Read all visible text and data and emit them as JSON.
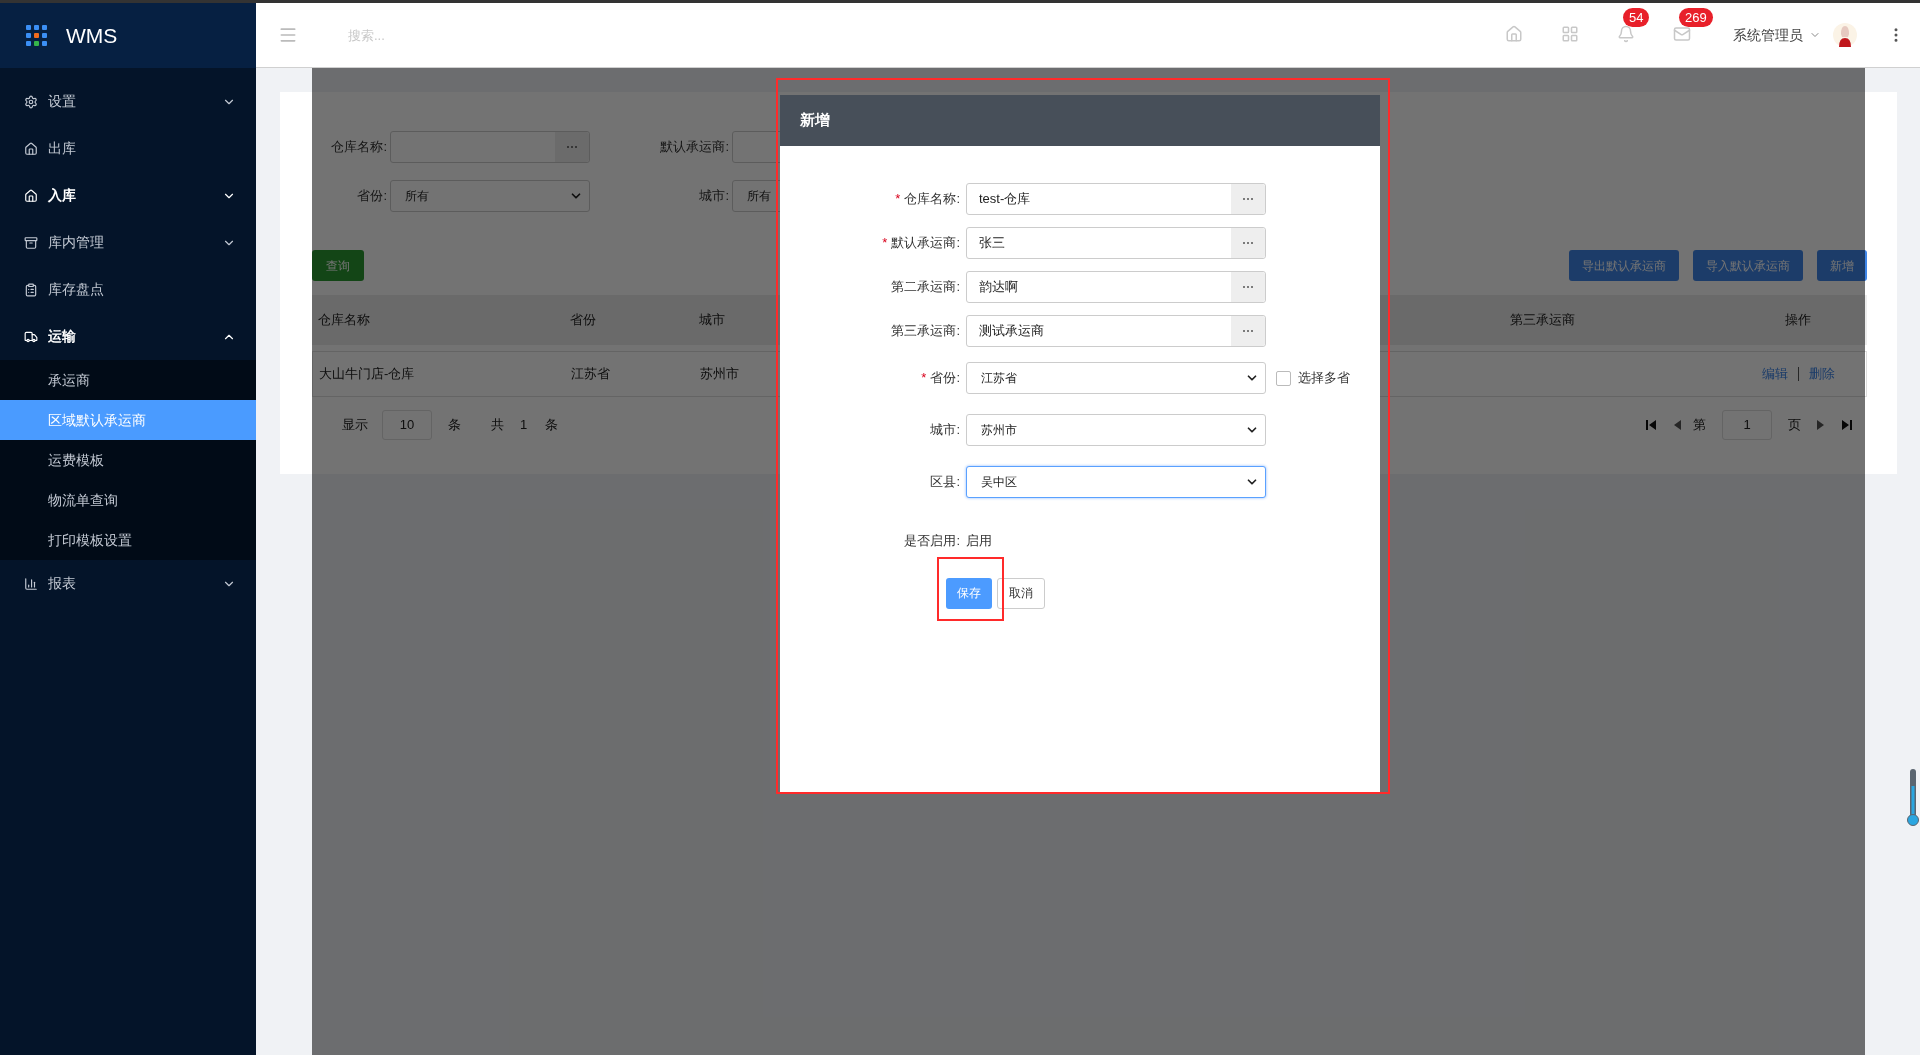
{
  "app": {
    "logo": "WMS"
  },
  "sidebar": {
    "items": [
      {
        "label": "设置",
        "kind": "group",
        "expanded": false,
        "bold": false
      },
      {
        "label": "出库",
        "kind": "link",
        "bold": false
      },
      {
        "label": "入库",
        "kind": "group",
        "expanded": false,
        "bold": true
      },
      {
        "label": "库内管理",
        "kind": "group",
        "expanded": false,
        "bold": false
      },
      {
        "label": "库存盘点",
        "kind": "link",
        "bold": false
      },
      {
        "label": "运输",
        "kind": "group",
        "expanded": true,
        "bold": true,
        "children": [
          {
            "label": "承运商",
            "selected": false
          },
          {
            "label": "区域默认承运商",
            "selected": true
          },
          {
            "label": "运费模板",
            "selected": false
          },
          {
            "label": "物流单查询",
            "selected": false
          },
          {
            "label": "打印模板设置",
            "selected": false
          }
        ]
      },
      {
        "label": "报表",
        "kind": "group",
        "expanded": false,
        "bold": false
      }
    ]
  },
  "header": {
    "search": {
      "placeholder": "搜索..."
    },
    "badges": [
      "54",
      "269"
    ],
    "user": "系统管理员"
  },
  "filters": [
    {
      "label": "仓库名称:",
      "kind": "picker"
    },
    {
      "label": "默认承运商:",
      "kind": "picker"
    },
    {
      "label": "省份:",
      "kind": "select",
      "value": "所有"
    },
    {
      "label": "城市:",
      "kind": "select",
      "value": "所有"
    }
  ],
  "query_button": "查询",
  "actions": [
    "导出默认承运商",
    "导入默认承运商",
    "新增"
  ],
  "table": {
    "columns": [
      "仓库名称",
      "省份",
      "城市",
      "第三承运商",
      "操作"
    ],
    "rows": [
      {
        "cells": [
          "大山牛门店-仓库",
          "江苏省",
          "苏州市"
        ],
        "links": [
          "编辑",
          "删除"
        ]
      }
    ]
  },
  "pagination": {
    "show": "显示",
    "page_size": "10",
    "unit": "条",
    "total_prefix": "共",
    "total": "1",
    "total_unit": "条",
    "page_prefix": "第",
    "page": "1",
    "page_suffix": "页"
  },
  "dialog": {
    "title": "新增",
    "fields": [
      {
        "label": "仓库名称:",
        "required_mark": "*",
        "kind": "picker",
        "value": "test-仓库"
      },
      {
        "label": "默认承运商:",
        "required_mark": "*",
        "kind": "picker",
        "value": "张三"
      },
      {
        "label": "第二承运商:",
        "kind": "picker",
        "value": "韵达啊"
      },
      {
        "label": "第三承运商:",
        "kind": "picker",
        "value": "测试承运商"
      },
      {
        "label": "省份:",
        "required_mark": "*",
        "kind": "select",
        "value": "江苏省",
        "focused": false,
        "option": {
          "label": "选择多省",
          "checked": false
        }
      },
      {
        "label": "城市:",
        "kind": "select",
        "value": "苏州市",
        "focused": false
      },
      {
        "label": "区县:",
        "kind": "select",
        "value": "吴中区",
        "focused": true
      },
      {
        "label": "是否启用:",
        "kind": "text",
        "value": "启用"
      }
    ],
    "buttons": [
      {
        "label": "保存",
        "kind": "primary"
      },
      {
        "label": "取消",
        "kind": "default"
      }
    ]
  }
}
